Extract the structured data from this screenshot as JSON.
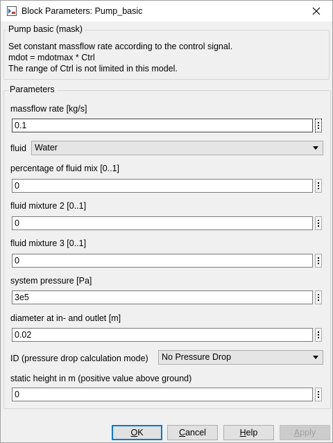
{
  "window": {
    "title": "Block Parameters: Pump_basic"
  },
  "mask": {
    "legend": "Pump basic (mask)",
    "lines": [
      "Set constant massflow rate according to the control signal.",
      "mdot = mdotmax * Ctrl",
      "The range of Ctrl is not limited in this model."
    ]
  },
  "params": {
    "legend": "Parameters",
    "massflow_label": "massflow rate [kg/s]",
    "massflow_value": "0.1",
    "fluid_label": "fluid",
    "fluid_value": "Water",
    "mix_label": "percentage of fluid mix [0..1]",
    "mix_value": "0",
    "mixture2_label": "fluid mixture 2 [0..1]",
    "mixture2_value": "0",
    "mixture3_label": "fluid mixture 3 [0..1]",
    "mixture3_value": "0",
    "pressure_label": "system pressure [Pa]",
    "pressure_value": "3e5",
    "diameter_label": "diameter at in- and outlet [m]",
    "diameter_value": "0.02",
    "id_label": "ID (pressure drop calculation mode)",
    "id_value": "No Pressure Drop",
    "height_label": "static height in m (positive value above ground)",
    "height_value": "0"
  },
  "buttons": {
    "ok": {
      "mnemonic": "O",
      "rest": "K"
    },
    "cancel": {
      "mnemonic": "C",
      "rest": "ancel"
    },
    "help": {
      "mnemonic": "H",
      "rest": "elp"
    },
    "apply": {
      "mnemonic": "A",
      "rest": "pply"
    }
  },
  "icons": [
    "simulink-block-icon",
    "close-icon",
    "more-options-icon",
    "chevron-down-icon"
  ]
}
